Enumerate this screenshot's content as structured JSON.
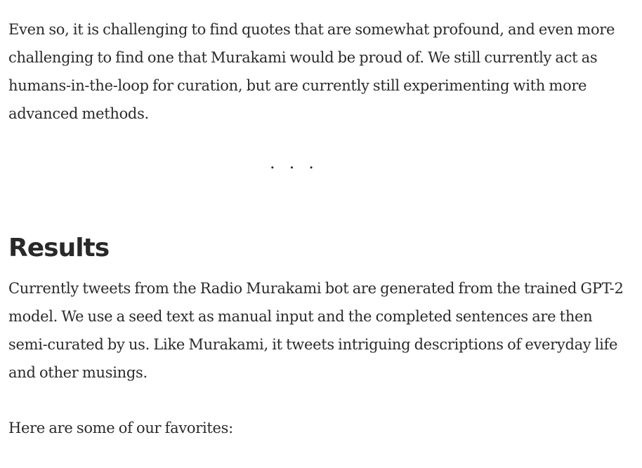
{
  "article": {
    "paragraph_1": "Even so, it is challenging to find quotes that are somewhat profound, and even more challenging to find one that Murakami would be proud of. We still currently act as humans-in-the-loop for curation, but are currently still experimenting with more advanced methods.",
    "separator": "...",
    "heading": "Results",
    "paragraph_2": "Currently tweets from the Radio Murakami bot are generated from the trained GPT-2 model. We use a seed text as manual input and the completed sentences are then semi-curated by us. Like Murakami, it tweets intriguing descriptions of everyday life and other musings.",
    "paragraph_3": "Here are some of our favorites:"
  }
}
